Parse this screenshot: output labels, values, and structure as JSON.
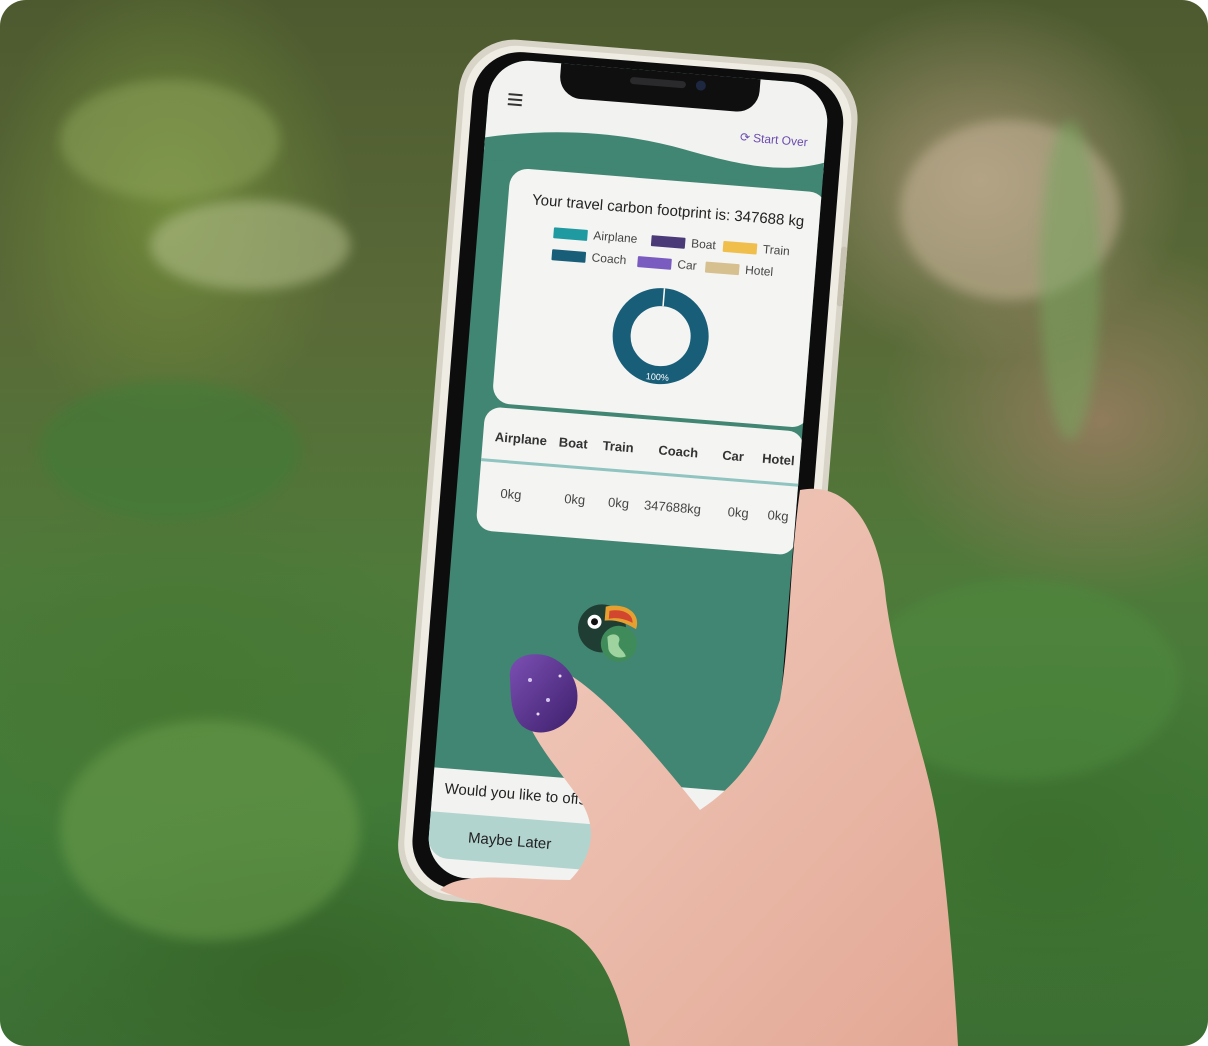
{
  "app": {
    "start_over_label": "Start Over",
    "refresh_icon": "refresh-icon",
    "menu_icon": "hamburger-menu-icon"
  },
  "summary": {
    "title": "Your travel carbon footprint is: 347688 kg"
  },
  "legend": [
    {
      "label": "Airplane",
      "color": "#1e9aa0"
    },
    {
      "label": "Boat",
      "color": "#4b3a78"
    },
    {
      "label": "Train",
      "color": "#f0be4a"
    },
    {
      "label": "Coach",
      "color": "#195e78"
    },
    {
      "label": "Car",
      "color": "#7a5bc0"
    },
    {
      "label": "Hotel",
      "color": "#d6c08f"
    }
  ],
  "chart_data": {
    "type": "pie",
    "categories": [
      "Airplane",
      "Boat",
      "Train",
      "Coach",
      "Car",
      "Hotel"
    ],
    "values": [
      0,
      0,
      0,
      347688,
      0,
      0
    ],
    "data_labels": [
      "100%"
    ]
  },
  "table": {
    "headers": [
      "Airplane",
      "Boat",
      "Train",
      "Coach",
      "Car",
      "Hotel"
    ],
    "values": [
      "0kg",
      "0kg",
      "0kg",
      "347688kg",
      "0kg",
      "0kg"
    ]
  },
  "offset": {
    "prompt": "Would you like to offset yo",
    "maybe_later_label": "Maybe Later"
  },
  "colors": {
    "screen_bg": "#418573",
    "accent_link": "#6a4bb0",
    "table_rule": "#8fc4c0",
    "button_bg": "#b2d4cf"
  }
}
